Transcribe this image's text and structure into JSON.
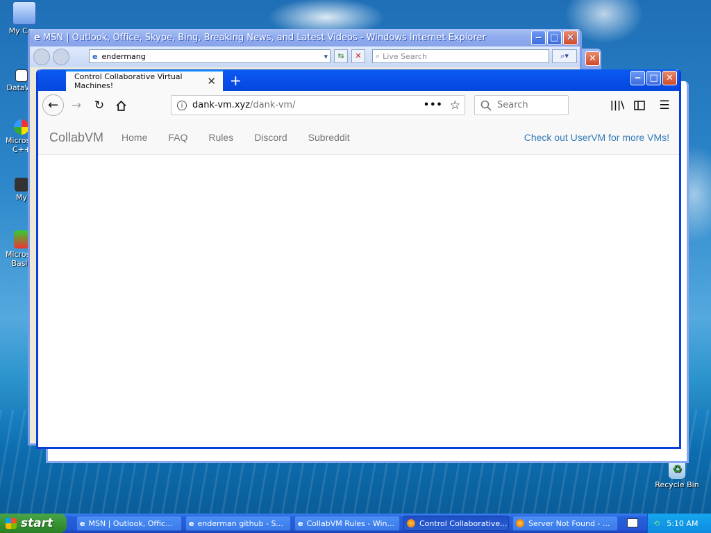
{
  "desktop": {
    "icons": [
      {
        "label": "My Com"
      },
      {
        "label": "DataWa"
      },
      {
        "label": "Microsof C++"
      },
      {
        "label": "My"
      },
      {
        "label": "Microsof Basic"
      },
      {
        "label": "Recycle Bin"
      }
    ]
  },
  "ie_window": {
    "title": "MSN | Outlook, Office, Skype, Bing, Breaking News, and Latest Videos - Windows Internet Explorer",
    "address": "endermang",
    "search_placeholder": "Live Search"
  },
  "firefox": {
    "tab_title": "Control Collaborative Virtual Machines!",
    "url_domain": "dank-vm.xyz",
    "url_path": "/dank-vm/",
    "search_placeholder": "Search"
  },
  "page": {
    "brand": "CollabVM",
    "nav": [
      "Home",
      "FAQ",
      "Rules",
      "Discord",
      "Subreddit"
    ],
    "right_link": "Check out UserVM for more VMs!"
  },
  "taskbar": {
    "start_label": "start",
    "tasks": [
      "MSN | Outlook, Offic...",
      "enderman github - S...",
      "CollabVM Rules - Win...",
      "Control Collaborative...",
      "Server Not Found - ..."
    ],
    "clock": "5:10 AM"
  },
  "colors": {
    "firefox_title": "#0546dd",
    "link_blue": "#337ab7",
    "taskbar_blue": "#2456d5"
  }
}
